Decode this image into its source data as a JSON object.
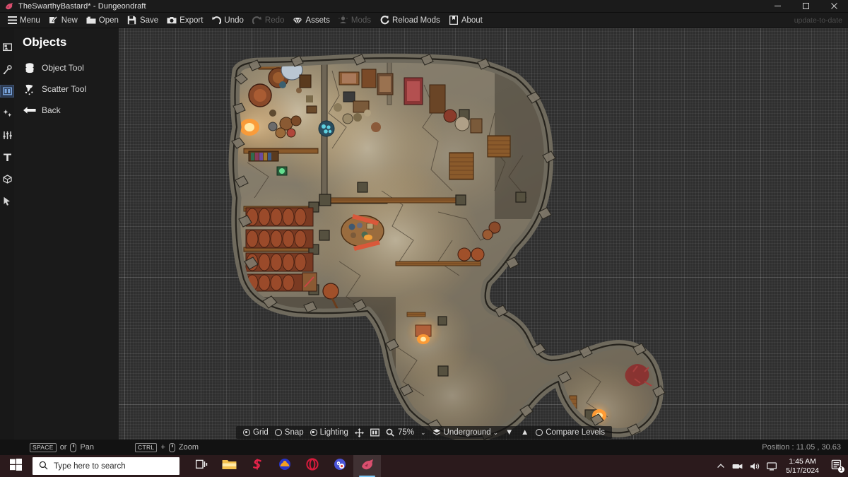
{
  "window": {
    "title": "TheSwarthyBastard* - Dungeondraft",
    "app_icon": "dungeondraft-icon",
    "minimize": "minimize-icon",
    "maximize": "maximize-icon",
    "close": "close-icon"
  },
  "toolbar": {
    "items": [
      {
        "label": "Menu",
        "icon": "hamburger-icon",
        "disabled": false
      },
      {
        "label": "New",
        "icon": "new-file-icon",
        "disabled": false
      },
      {
        "label": "Open",
        "icon": "folder-icon",
        "disabled": false
      },
      {
        "label": "Save",
        "icon": "floppy-icon",
        "disabled": false
      },
      {
        "label": "Export",
        "icon": "camera-icon",
        "disabled": false
      },
      {
        "label": "Undo",
        "icon": "undo-arrow-icon",
        "disabled": false
      },
      {
        "label": "Redo",
        "icon": "redo-arrow-icon",
        "disabled": true
      },
      {
        "label": "Assets",
        "icon": "gem-icon",
        "disabled": false
      },
      {
        "label": "Mods",
        "icon": "mods-icon",
        "disabled": true
      },
      {
        "label": "Reload Mods",
        "icon": "reload-icon",
        "disabled": false
      },
      {
        "label": "About",
        "icon": "book-icon",
        "disabled": false
      }
    ],
    "update_status": "update-to-date"
  },
  "rail": {
    "items": [
      {
        "name": "ground-tool",
        "icon": "ground-icon",
        "active": false
      },
      {
        "name": "paths-tool",
        "icon": "path-icon",
        "active": false
      },
      {
        "name": "objects-tool",
        "icon": "objects-icon",
        "active": true
      },
      {
        "name": "lights-tool",
        "icon": "sparkle-icon",
        "active": false
      },
      {
        "name": "terrain-tool",
        "icon": "sliders-icon",
        "active": false
      },
      {
        "name": "text-tool",
        "icon": "text-icon",
        "active": false
      },
      {
        "name": "roofs-tool",
        "icon": "cube-icon",
        "active": false
      },
      {
        "name": "select-tool",
        "icon": "cursor-icon",
        "active": false
      }
    ]
  },
  "panel": {
    "title": "Objects",
    "items": [
      {
        "label": "Object Tool",
        "icon": "object-stack-icon"
      },
      {
        "label": "Scatter Tool",
        "icon": "scatter-icon"
      },
      {
        "label": "Back",
        "icon": "back-arrow-icon"
      }
    ]
  },
  "mapbar": {
    "grid_label": "Grid",
    "grid_on": true,
    "snap_label": "Snap",
    "snap_on": false,
    "lighting_label": "Lighting",
    "lighting_on": true,
    "move_icon": "move-handle-icon",
    "level_icon": "level-icon",
    "zoom_icon": "magnifier-icon",
    "zoom_value": "75%",
    "zoom_caret": "⌄",
    "level_select_icon": "layers-icon",
    "level_value": "Underground",
    "level_caret": "⌄",
    "level_down": "▼",
    "level_up": "▲",
    "compare_label": "Compare Levels",
    "compare_on": false
  },
  "statusbar": {
    "pan_key": "SPACE",
    "pan_or": "or",
    "pan_label": "Pan",
    "zoom_key": "CTRL",
    "zoom_plus": "+",
    "zoom_label": "Zoom",
    "position": "Position : 11.05 , 30.63"
  },
  "taskbar": {
    "start_icon": "windows-start-icon",
    "search_icon": "search-icon",
    "search_placeholder": "Type here to search",
    "search_value": "",
    "apps": [
      {
        "name": "task-view-icon",
        "active": false
      },
      {
        "name": "file-explorer-icon",
        "active": false
      },
      {
        "name": "s-app-icon",
        "active": false
      },
      {
        "name": "orange-app-icon",
        "active": false
      },
      {
        "name": "opera-icon",
        "active": false
      },
      {
        "name": "discord-icon",
        "active": false
      },
      {
        "name": "dungeondraft-icon",
        "active": true
      }
    ],
    "tray": {
      "chevron": "chevron-up-icon",
      "icons": [
        "usb-icon",
        "volume-icon",
        "network-icon"
      ],
      "time": "1:45 AM",
      "date": "5/17/2024",
      "notification_icon": "notification-icon",
      "notification_count": "1"
    }
  },
  "colors": {
    "canvas_bg": "#2f2f2f",
    "chrome_bg": "#1b1b1b",
    "panel_bg": "#1a1a1a",
    "accent": "#7ba7e0",
    "taskbar_bg": "#2b1a1c",
    "map_floor": "#cdbfa4",
    "map_wall": "#8d8577",
    "map_wood": "#8a5a2b"
  }
}
